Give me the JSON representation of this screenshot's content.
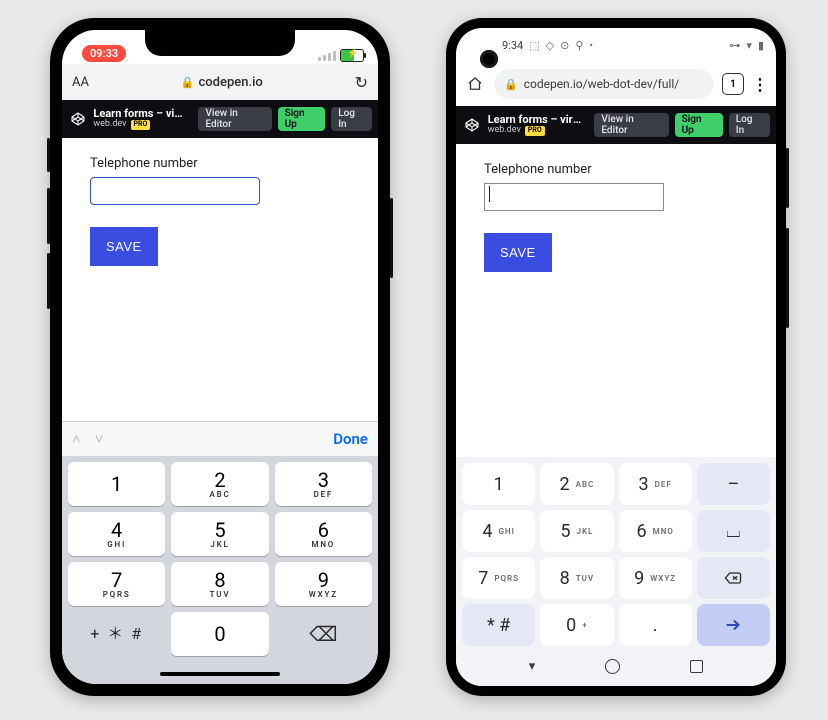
{
  "ios": {
    "status": {
      "time": "09:33"
    },
    "safari": {
      "aa": "AA",
      "host": "codepen.io"
    },
    "codepen": {
      "title": "Learn forms – virt…",
      "author": "web.dev",
      "pro": "PRO",
      "view": "View in Editor",
      "signup": "Sign Up",
      "login": "Log In"
    },
    "form": {
      "label": "Telephone number",
      "save": "SAVE"
    },
    "kb": {
      "done": "Done",
      "symbols": "+ ＊ #",
      "keys": [
        {
          "n": "1",
          "s": ""
        },
        {
          "n": "2",
          "s": "ABC"
        },
        {
          "n": "3",
          "s": "DEF"
        },
        {
          "n": "4",
          "s": "GHI"
        },
        {
          "n": "5",
          "s": "JKL"
        },
        {
          "n": "6",
          "s": "MNO"
        },
        {
          "n": "7",
          "s": "PQRS"
        },
        {
          "n": "8",
          "s": "TUV"
        },
        {
          "n": "9",
          "s": "WXYZ"
        }
      ],
      "zero": "0"
    }
  },
  "android": {
    "status": {
      "time": "9:34"
    },
    "url": "codepen.io/web-dot-dev/full/",
    "tabcount": "1",
    "codepen": {
      "title": "Learn forms – virt…",
      "author": "web.dev",
      "pro": "PRO",
      "view": "View in Editor",
      "signup": "Sign Up",
      "login": "Log In"
    },
    "form": {
      "label": "Telephone number",
      "save": "SAVE"
    },
    "kb": {
      "rows": [
        [
          {
            "n": "1",
            "s": ""
          },
          {
            "n": "2",
            "s": "ABC"
          },
          {
            "n": "3",
            "s": "DEF"
          },
          {
            "sym": "–",
            "ghost": true
          }
        ],
        [
          {
            "n": "4",
            "s": "GHI"
          },
          {
            "n": "5",
            "s": "JKL"
          },
          {
            "n": "6",
            "s": "MNO"
          },
          {
            "sym": "⌴",
            "ghost": true
          }
        ],
        [
          {
            "n": "7",
            "s": "PQRS"
          },
          {
            "n": "8",
            "s": "TUV"
          },
          {
            "n": "9",
            "s": "WXYZ"
          },
          {
            "icon": "backspace",
            "ghost": true
          }
        ],
        [
          {
            "n": "* #",
            "s": "",
            "ghost": true
          },
          {
            "n": "0",
            "s": "+"
          },
          {
            "n": ".",
            "s": "",
            "ghost": false
          },
          {
            "icon": "enter",
            "action": true
          }
        ]
      ]
    }
  }
}
